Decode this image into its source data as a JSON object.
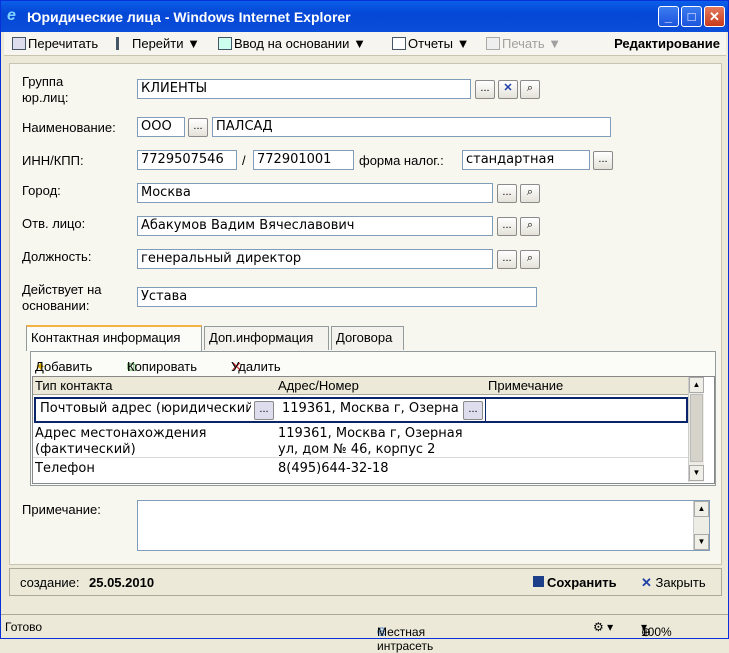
{
  "window": {
    "title": "Юридические лица - Windows Internet Explorer"
  },
  "toolbar": {
    "reread": "Перечитать",
    "goto": "Перейти",
    "basis": "Ввод на основании",
    "reports": "Отчеты",
    "print": "Печать",
    "mode": "Редактирование"
  },
  "form": {
    "group_label": "Группа юр.лиц:",
    "group_value": "КЛИЕНТЫ",
    "name_label": "Наименование:",
    "name_form": "ООО",
    "name_value": "ПАЛСАД",
    "inn_label": "ИНН/КПП:",
    "inn_value": "7729507546",
    "sep": "/",
    "kpp_value": "772901001",
    "tax_label": "форма налог.:",
    "tax_value": "стандартная",
    "city_label": "Город:",
    "city_value": "Москва",
    "person_label": "Отв. лицо:",
    "person_value": "Абакумов Вадим Вячеславович",
    "position_label": "Должность:",
    "position_value": "генеральный директор",
    "basis_label": "Действует на основании:",
    "basis_value": "Устава",
    "note_label": "Примечание:",
    "note_value": ""
  },
  "tabs": [
    "Контактная информация",
    "Доп.информация",
    "Договора"
  ],
  "grid_toolbar": {
    "add": "Добавить",
    "copy": "Копировать",
    "delete": "Удалить"
  },
  "grid": {
    "columns": [
      "Тип контакта",
      "Адрес/Номер",
      "Примечание"
    ],
    "rows": [
      {
        "type": "Почтовый адрес (юридический",
        "address": "119361, Москва г, Озерна",
        "note": ""
      },
      {
        "type": "Адрес местонахождения (фактический)",
        "address": "119361, Москва г, Озерная ул, дом № 46, корпус 2",
        "note": ""
      },
      {
        "type": "Телефон",
        "address": "8(495)644-32-18",
        "note": ""
      }
    ]
  },
  "footer": {
    "created_label": "создание:",
    "created_date": "25.05.2010",
    "save": "Сохранить",
    "close": "Закрыть"
  },
  "statusbar": {
    "left": "Готово",
    "zone": "Местная интрасеть",
    "zoom": "100%"
  }
}
